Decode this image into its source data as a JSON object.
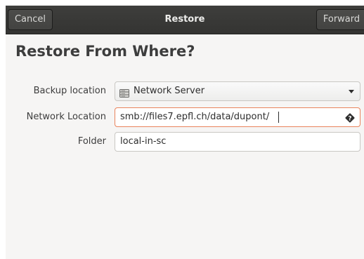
{
  "header": {
    "cancel_label": "Cancel",
    "title": "Restore",
    "forward_label": "Forward"
  },
  "page_title": "Restore From Where?",
  "form": {
    "backup_location": {
      "label": "Backup location",
      "value": "Network Server",
      "icon": "server-icon"
    },
    "network_location": {
      "label": "Network Location",
      "value": "smb://files7.epfl.ch/data/dupont/",
      "icon": "help-icon"
    },
    "folder": {
      "label": "Folder",
      "value": "local-in-sc"
    }
  },
  "colors": {
    "headerbar": "#373735",
    "window_bg": "#f6f5f4",
    "focus_border": "#e9835c",
    "text": "#3d3d3d"
  }
}
